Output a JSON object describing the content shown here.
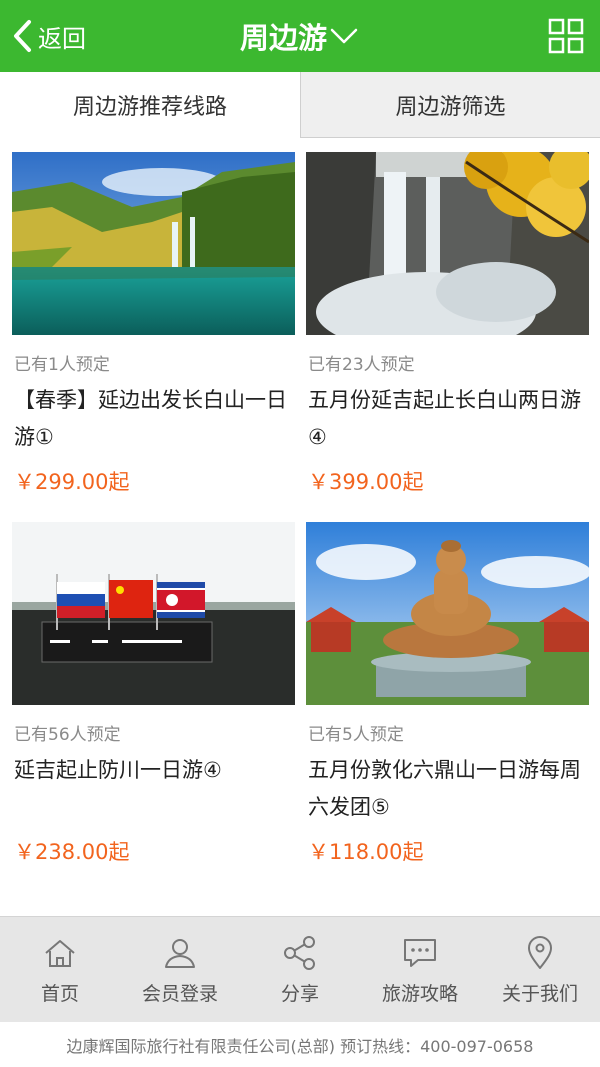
{
  "header": {
    "back_label": "返回",
    "title": "周边游",
    "menu_icon": "grid-icon"
  },
  "tabs": [
    {
      "label": "周边游推荐线路",
      "active": true
    },
    {
      "label": "周边游筛选",
      "active": false
    }
  ],
  "products": [
    {
      "booked": "已有1人预定",
      "name": "【春季】延边出发长白山一日游①",
      "price": "￥299.00起"
    },
    {
      "booked": "已有23人预定",
      "name": "五月份延吉起止长白山两日游④",
      "price": "￥399.00起"
    },
    {
      "booked": "已有56人预定",
      "name": "延吉起止防川一日游④",
      "price": "￥238.00起"
    },
    {
      "booked": "已有5人预定",
      "name": "五月份敦化六鼎山一日游每周六发团⑤",
      "price": "￥118.00起"
    }
  ],
  "bottom_nav": [
    {
      "label": "首页",
      "icon": "home-icon"
    },
    {
      "label": "会员登录",
      "icon": "user-icon"
    },
    {
      "label": "分享",
      "icon": "share-icon"
    },
    {
      "label": "旅游攻略",
      "icon": "chat-icon"
    },
    {
      "label": "关于我们",
      "icon": "location-icon"
    }
  ],
  "footer": {
    "text": "边康辉国际旅行社有限责任公司(总部) 预订热线：400-097-0658"
  },
  "colors": {
    "brand_green": "#3cb830",
    "price_orange": "#f2641e"
  }
}
